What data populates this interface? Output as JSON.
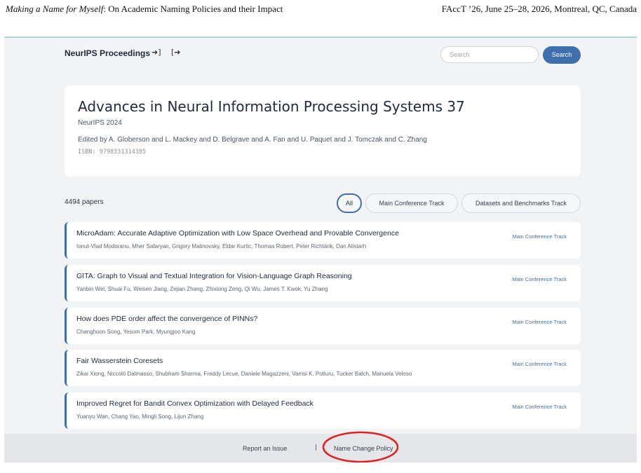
{
  "paper_header": {
    "left_italic": "Making a Name for Myself",
    "left_rest": ": On Academic Naming Policies and their Impact",
    "right": "FAccT ’26, June 25–28, 2026, Montreal, QC, Canada"
  },
  "nav": {
    "brand": "NeurIPS Proceedings",
    "login_icon": "login-icon",
    "logout_icon": "logout-icon",
    "search_placeholder": "Search",
    "search_button": "Search"
  },
  "proceedings": {
    "title": "Advances in Neural Information Processing Systems 37",
    "conference": "NeurIPS 2024",
    "editors": "Edited by A. Globerson and L. Mackey and D. Belgrave and A. Fan and U. Paquet and J. Tomczak and C. Zhang",
    "isbn": "ISBN: 9798331314385"
  },
  "filter": {
    "count": "4494 papers",
    "pills": [
      {
        "label": "All",
        "active": true
      },
      {
        "label": "Main Conference Track",
        "active": false
      },
      {
        "label": "Datasets and Benchmarks Track",
        "active": false
      }
    ]
  },
  "papers": [
    {
      "title": "MicroAdam: Accurate Adaptive Optimization with Low Space Overhead and Provable Convergence",
      "authors": "Ionut-Vlad Modoranu, Mher Safaryan, Grigory Malinovsky, Eldar Kurtic, Thomas Robert, Peter Richtárik, Dan Alistarh",
      "track": "Main Conference Track"
    },
    {
      "title": "GITA: Graph to Visual and Textual Integration for Vision-Language Graph Reasoning",
      "authors": "Yanbin Wei, Shuai Fu, Weisen Jiang, Zejian Zhang, Zhixiong Zeng, Qi Wu, James T. Kwok, Yu Zhang",
      "track": "Main Conference Track"
    },
    {
      "title": "How does PDE order affect the convergence of PINNs?",
      "authors": "Changhoon Song, Yesom Park, Myungjoo Kang",
      "track": "Main Conference Track"
    },
    {
      "title": "Fair Wasserstein Coresets",
      "authors": "Zikai Xiong, Niccolò Dalmasso, Shubham Sharma, Freddy Lecue, Daniele Magazzeni, Vamsi K. Potluru, Tucker Balch, Manuela Veloso",
      "track": "Main Conference Track"
    },
    {
      "title": "Improved Regret for Bandit Convex Optimization with Delayed Feedback",
      "authors": "Yuanyu Wan, Chang Yao, Mingli Song, Lijun Zhang",
      "track": "Main Conference Track"
    }
  ],
  "footer": {
    "report": "Report an Issue",
    "separator": "|",
    "policy": "Name Change Policy"
  },
  "colors": {
    "accent": "#3f6fad",
    "highlight_circle": "#e02020"
  }
}
